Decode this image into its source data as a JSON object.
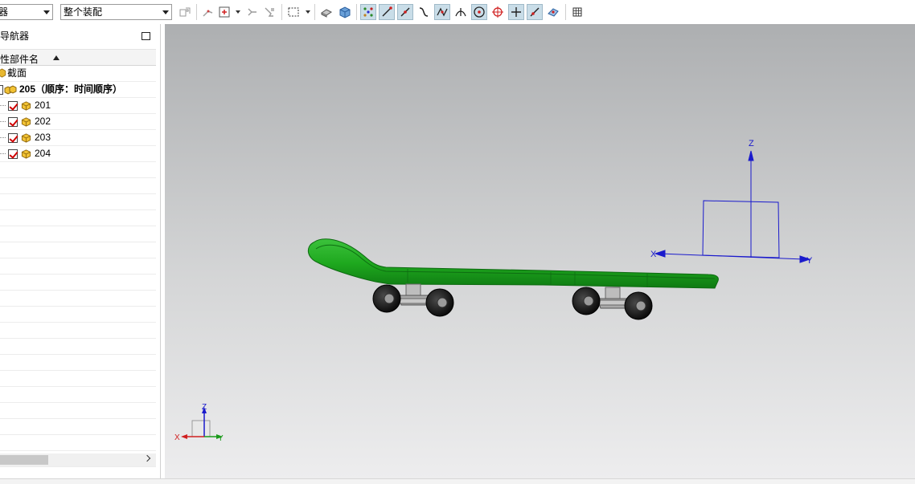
{
  "toolbar": {
    "filter_combo_value": "器",
    "assembly_combo_value": "整个装配",
    "icons": [
      "component-filter-icon",
      "sketch-select-icon",
      "select-box-icon",
      "move-icon",
      "smart-select-icon",
      "rectangle-select-icon",
      "shaded-face-icon",
      "solid-body-icon",
      "snap-points-icon",
      "end-point-icon",
      "mid-point-icon",
      "curve-icon",
      "intersection-icon",
      "perpendicular-icon",
      "center-point-icon",
      "quadrant-icon",
      "cross-point-icon",
      "on-curve-icon",
      "point-on-face-icon",
      "grid-icon"
    ]
  },
  "navigator": {
    "title": "导航器",
    "column_header": "性部件名",
    "tree": [
      {
        "label": "截面",
        "level": 0,
        "bold": false,
        "checked": null
      },
      {
        "label": "205（顺序：时间顺序）",
        "level": 0,
        "bold": true,
        "checked": null
      },
      {
        "label": "201",
        "level": 1,
        "bold": false,
        "checked": true
      },
      {
        "label": "202",
        "level": 1,
        "bold": false,
        "checked": true
      },
      {
        "label": "203",
        "level": 1,
        "bold": false,
        "checked": true
      },
      {
        "label": "204",
        "level": 1,
        "bold": false,
        "checked": true
      }
    ],
    "empty_rows": 19
  },
  "viewport": {
    "csys_labels": {
      "x": "X",
      "y": "Y",
      "z": "Z"
    },
    "triad_labels": {
      "x": "X",
      "y": "Y",
      "z": "Z"
    },
    "model": "skateboard",
    "colors": {
      "deck": "#1ea81e",
      "csys": "#1a1acc",
      "wheels": "#1c1c1c",
      "trucks": "#b8b8b8"
    }
  }
}
